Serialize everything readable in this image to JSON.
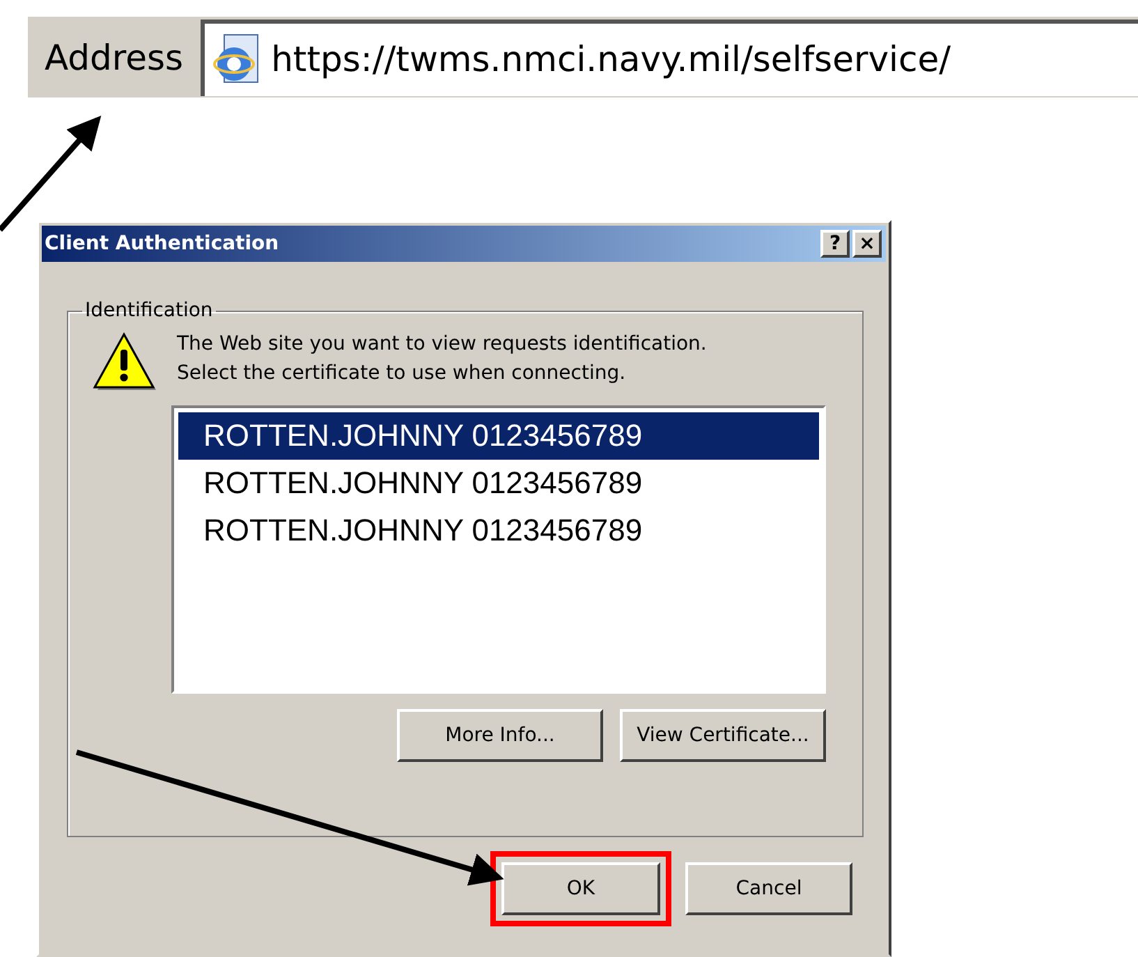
{
  "address_bar": {
    "label": "Address",
    "url": "https://twms.nmci.navy.mil/selfservice/"
  },
  "dialog": {
    "title": "Client Authentication",
    "title_buttons": [
      "?",
      "×"
    ],
    "group_label": "Identification",
    "message": "The Web site you want to view requests identification.\nSelect the certificate to use when connecting.",
    "certificates": [
      {
        "label": "ROTTEN.JOHNNY 0123456789",
        "selected": true
      },
      {
        "label": "ROTTEN.JOHNNY 0123456789",
        "selected": false
      },
      {
        "label": "ROTTEN.JOHNNY 0123456789",
        "selected": false
      }
    ],
    "list_buttons": [
      "More Info...",
      "View Certificate..."
    ],
    "buttons": [
      {
        "label": "OK",
        "highlighted": true
      },
      {
        "label": "Cancel",
        "highlighted": false
      }
    ]
  }
}
